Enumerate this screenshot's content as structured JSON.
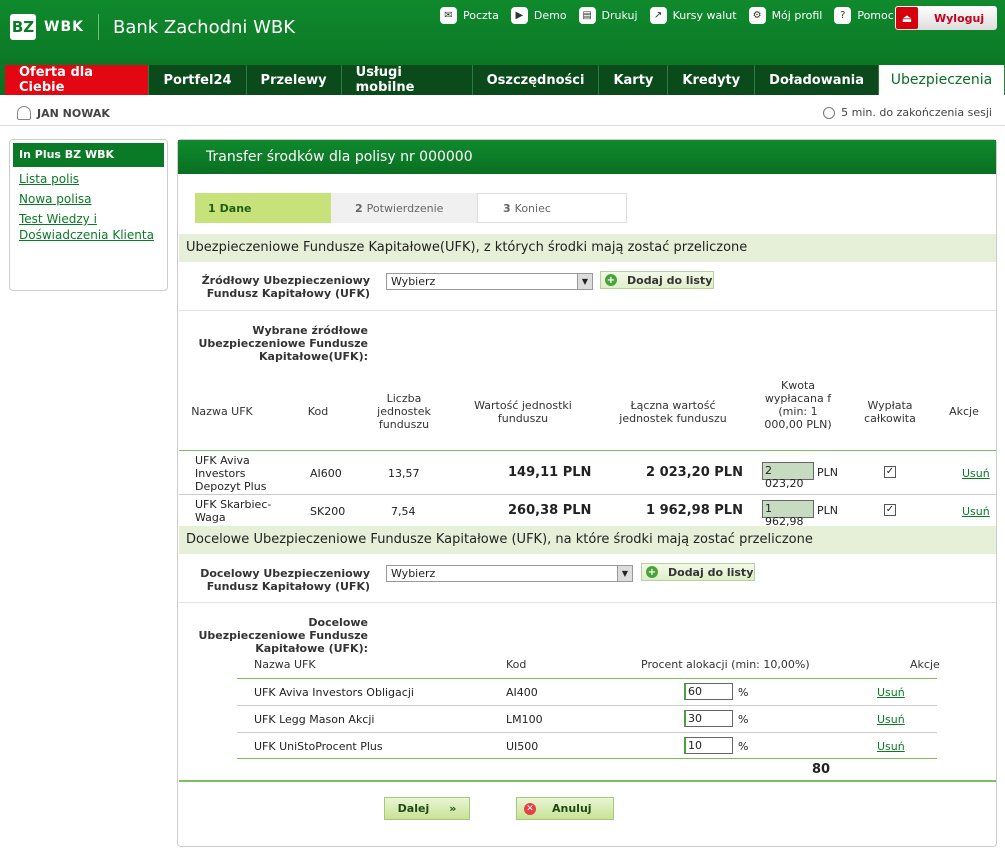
{
  "header": {
    "logo_mark": "BZ",
    "logo_text": "WBK",
    "bank_name": "Bank Zachodni WBK",
    "links": [
      "Poczta",
      "Demo",
      "Drukuj",
      "Kursy walut",
      "Mój profil",
      "Pomoc"
    ],
    "logout": "Wyloguj"
  },
  "nav": [
    "Oferta dla Ciebie",
    "Portfel24",
    "Przelewy",
    "Usługi mobilne",
    "Oszczędności",
    "Karty",
    "Kredyty",
    "Doładowania",
    "Ubezpieczenia"
  ],
  "user": {
    "name": "JAN NOWAK",
    "session": "5 min. do zakończenia sesji"
  },
  "sidebar": {
    "title": "In Plus BZ WBK",
    "links": [
      "Lista polis",
      "Nowa polisa",
      "Test Wiedzy i Doświadczenia Klienta"
    ]
  },
  "main": {
    "title": "Transfer środków dla polisy nr 000000",
    "steps": [
      {
        "num": "1",
        "label": "Dane"
      },
      {
        "num": "2",
        "label": "Potwierdzenie"
      },
      {
        "num": "3",
        "label": "Koniec"
      }
    ],
    "source_section": "Ubezpieczeniowe Fundusze Kapitałowe(UFK), z których środki mają zostać przeliczone",
    "source_field_label": "Źródłowy Ubezpieczeniowy Fundusz Kapitałowy (UFK)",
    "select_value": "Wybierz",
    "add_button": "Dodaj do listy",
    "selected_source_label": "Wybrane źródłowe Ubezpieczeniowe Fundusze Kapitałowe(UFK):",
    "source_columns": [
      "Nazwa UFK",
      "Kod",
      "Liczba jednostek funduszu",
      "Wartość jednostki funduszu",
      "Łączna wartość jednostek funduszu",
      "Kwota wypłacana f (min: 1 000,00 PLN)",
      "Wypłata całkowita",
      "Akcje"
    ],
    "source_rows": [
      {
        "name": "UFK Aviva Investors Depozyt Plus",
        "code": "AI600",
        "units": "13,57",
        "unit_value": "149,11 PLN",
        "total": "2 023,20 PLN",
        "amount": "2 023,20",
        "currency": "PLN",
        "full": "✓",
        "action": "Usuń"
      },
      {
        "name": "UFK Skarbiec-Waga",
        "code": "SK200",
        "units": "7,54",
        "unit_value": "260,38 PLN",
        "total": "1 962,98 PLN",
        "amount": "1 962,98",
        "currency": "PLN",
        "full": "✓",
        "action": "Usuń"
      }
    ],
    "target_section": "Docelowe Ubezpieczeniowe Fundusze Kapitałowe (UFK), na które środki mają zostać przeliczone",
    "target_field_label": "Docelowy Ubezpieczeniowy Fundusz Kapitałowy (UFK)",
    "selected_target_label": "Docelowe Ubezpieczeniowe Fundusze Kapitałowe (UFK):",
    "target_columns": [
      "Nazwa UFK",
      "Kod",
      "Procent alokacji (min: 10,00%)",
      "Akcje"
    ],
    "target_rows": [
      {
        "name": "UFK Aviva Investors Obligacji",
        "code": "AI400",
        "pct": "60",
        "unit": "%",
        "action": "Usuń"
      },
      {
        "name": "UFK Legg Mason Akcji",
        "code": "LM100",
        "pct": "30",
        "unit": "%",
        "action": "Usuń"
      },
      {
        "name": "UFK UniStoProcent Plus",
        "code": "UI500",
        "pct": "10",
        "unit": "%",
        "action": "Usuń"
      }
    ],
    "pct_total": "80",
    "next_button": "Dalej",
    "next_arrow": "»",
    "cancel_button": "Anuluj"
  }
}
